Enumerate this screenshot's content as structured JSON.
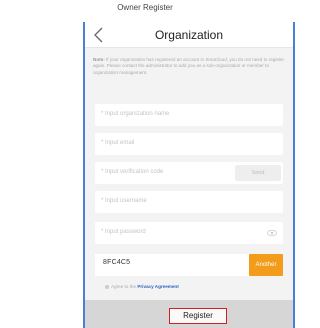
{
  "caption": "Owner Register",
  "header": {
    "title": "Organization"
  },
  "note": {
    "prefix": "Note:",
    "text": "If your organization has registered an account in SmaCloud, you do not need to register again. Please contact the administrator to add you as a sub-organization or member to organization management."
  },
  "form": {
    "organization_name": "* Input organization name",
    "email": "* Input email",
    "verification_code": "* Input verification code",
    "send_label": "Send",
    "username": "* Input username",
    "password": "* Input password",
    "captcha_value": "8FC4C5",
    "another_label": "Another"
  },
  "agreement": {
    "prefix": "Agree to the",
    "link": "Privacy Agreement"
  },
  "register_label": "Register",
  "colors": {
    "frame": "#4a7fd6",
    "accent_orange": "#f39b1a",
    "highlight_red": "#d22020",
    "link_blue": "#2b63c2"
  }
}
